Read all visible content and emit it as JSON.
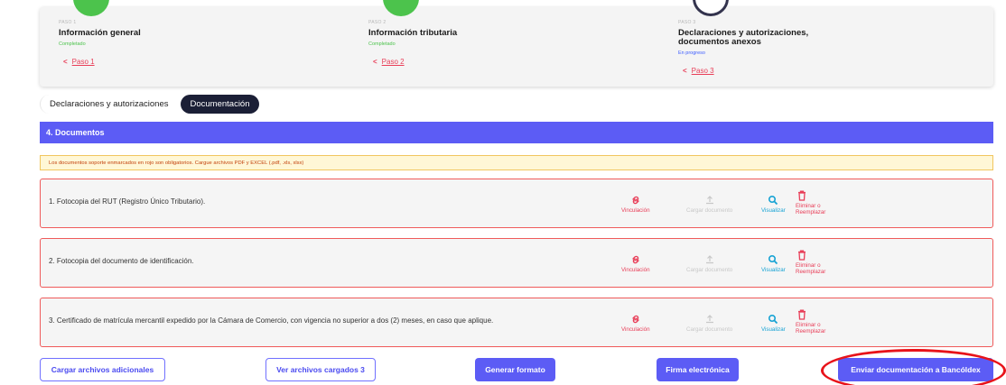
{
  "steps": [
    {
      "num": "PASO 1",
      "title": "Información general",
      "status": "Completado",
      "link": "Paso 1"
    },
    {
      "num": "PASO 2",
      "title": "Información tributaria",
      "status": "Completado",
      "link": "Paso 2"
    },
    {
      "num": "PASO 3",
      "title_line1": "Declaraciones y autorizaciones,",
      "title_line2": "documentos anexos",
      "status": "En progreso",
      "link": "Paso 3"
    }
  ],
  "tabs": {
    "declaraciones": "Declaraciones y autorizaciones",
    "documentacion": "Documentación"
  },
  "section_title": "4. Documentos",
  "notice": "Los documentos soporte enmarcados en rojo son obligatorios. Cargue archivos PDF y EXCEL (.pdf, .xls, xlsx)",
  "documents": [
    {
      "label": "1. Fotocopia del RUT (Registro Único Tributario)."
    },
    {
      "label": "2. Fotocopia del documento de identificación."
    },
    {
      "label": "3. Certificado de matrícula mercantil expedido por la Cámara de Comercio, con vigencia no superior a dos (2) meses, en caso que aplique."
    }
  ],
  "actions": {
    "vinculacion": "Vinculación",
    "cargar": "Cargar documento",
    "visualizar": "Visualizar",
    "eliminar_1": "Eliminar o",
    "eliminar_2": "Reemplazar"
  },
  "buttons": {
    "cargar_adicionales": "Cargar archivos adicionales",
    "ver_cargados": "Ver archivos cargados 3",
    "generar_formato": "Generar formato",
    "firma": "Firma electrónica",
    "enviar": "Enviar documentación a Bancóldex"
  },
  "colors": {
    "primary": "#5c5cf5",
    "success": "#4cc34c",
    "danger": "#e83e58",
    "info": "#17a3d4",
    "highlight": "#e8131a"
  }
}
